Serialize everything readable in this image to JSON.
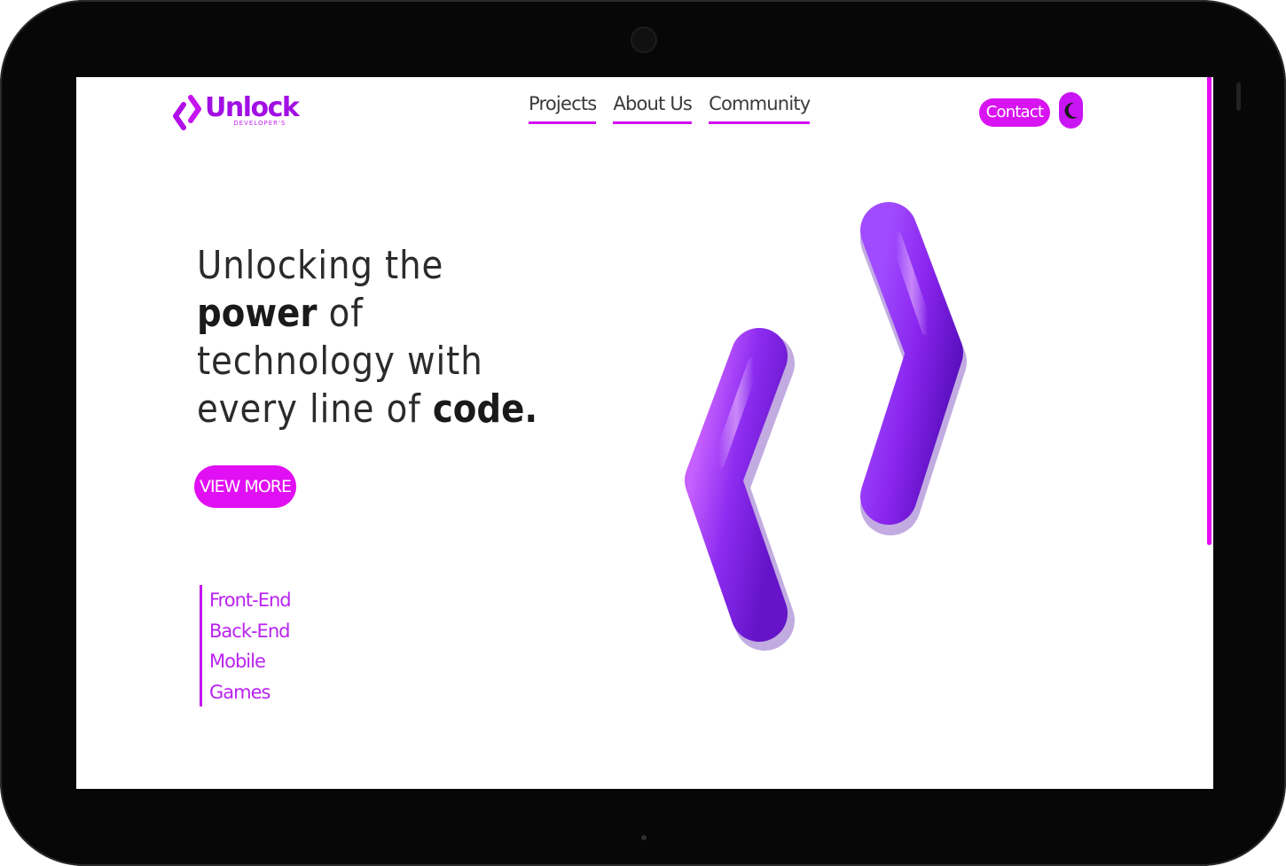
{
  "brand": {
    "name": "Unlock",
    "tagline": "DEVELOPER'S",
    "accent_color": "#d914f2",
    "logo_color": "#a20fe4"
  },
  "nav": {
    "items": [
      {
        "label": "Projects"
      },
      {
        "label": "About Us"
      },
      {
        "label": "Community"
      }
    ]
  },
  "header": {
    "contact_label": "Contact",
    "theme_icon": "moon-icon"
  },
  "hero": {
    "headline": {
      "line1": "Unlocking the",
      "line2_bold": "power",
      "line2_rest": " of",
      "line3": "technology with",
      "line4_rest": "every line of ",
      "line4_bold": "code."
    },
    "cta_label": "VIEW MORE",
    "services": [
      "Front-End",
      "Back-End",
      "Mobile",
      "Games"
    ],
    "art_icon": "code-brackets-3d-icon"
  }
}
